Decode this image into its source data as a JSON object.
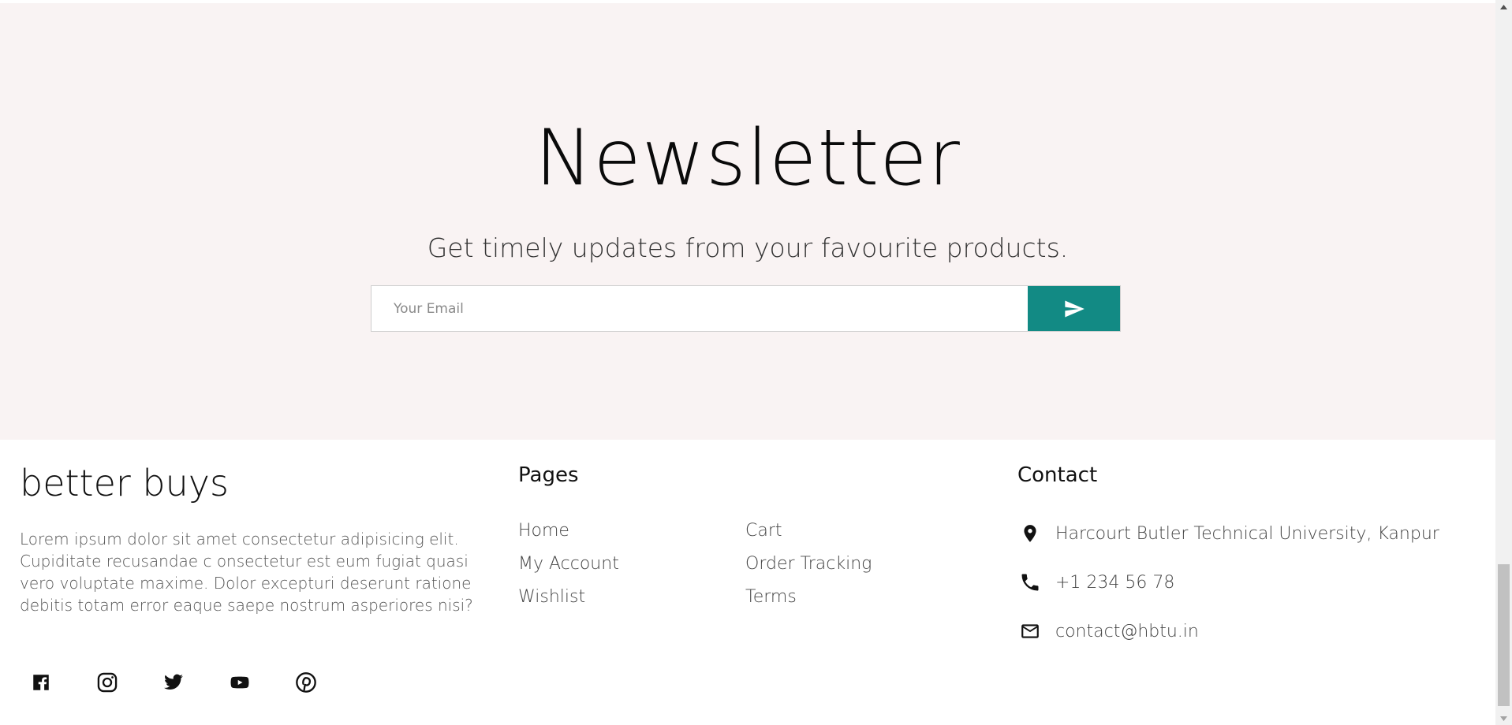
{
  "newsletter": {
    "title": "Newsletter",
    "subtitle": "Get timely updates from your favourite products.",
    "email_placeholder": "Your Email",
    "submit_icon": "send-icon"
  },
  "footer": {
    "brand": "better buys",
    "about": "Lorem ipsum dolor sit amet consectetur adipisicing elit. Cupiditate recusandae c onsectetur est eum fugiat quasi vero voluptate maxime. Dolor excepturi deserunt ratione debitis totam error eaque saepe nostrum asperiores nisi?",
    "socials": [
      "facebook-icon",
      "instagram-icon",
      "twitter-icon",
      "youtube-icon",
      "pinterest-icon"
    ],
    "pages_title": "Pages",
    "pages": [
      "Home",
      "Cart",
      "My Account",
      "Order Tracking",
      "Wishlist",
      "Terms"
    ],
    "contact_title": "Contact",
    "contact": {
      "address": "Harcourt Butler Technical University, Kanpur",
      "phone": "+1 234 56 78",
      "email": "contact@hbtu.in"
    }
  },
  "colors": {
    "newsletter_bg": "#f9f3f3",
    "accent": "#128a84"
  }
}
